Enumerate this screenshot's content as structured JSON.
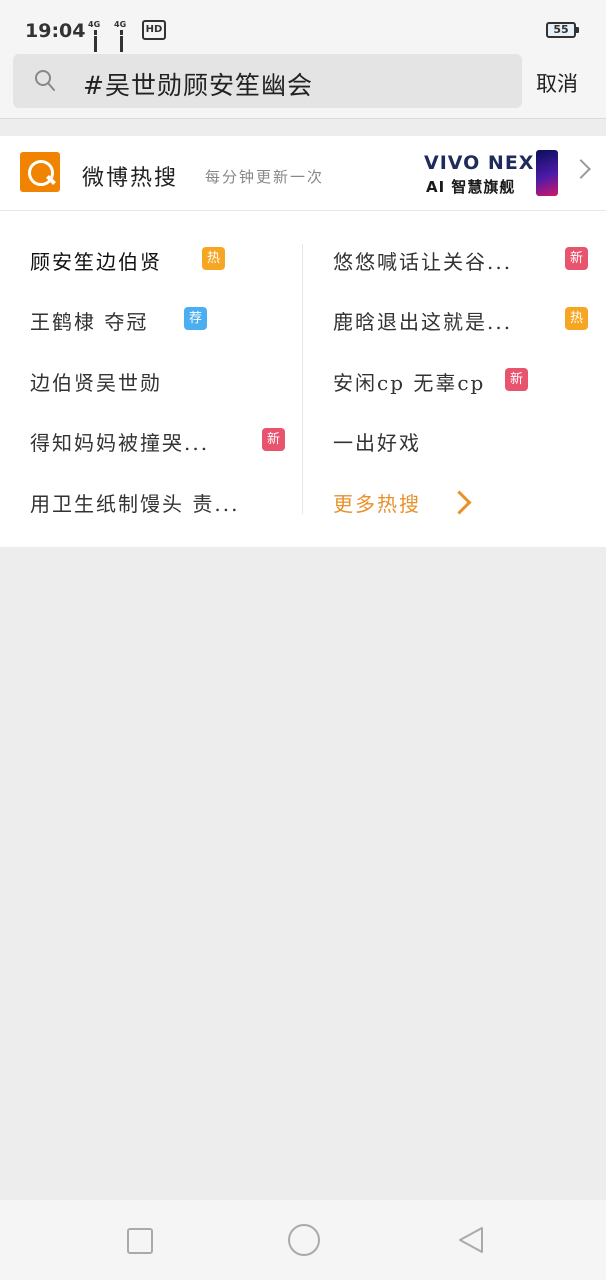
{
  "status_bar": {
    "time": "19:04",
    "network1": "4G",
    "network2": "4G",
    "hd_label": "HD",
    "battery": "55"
  },
  "search": {
    "query": "#吴世勋顾安笙幽会",
    "cancel_label": "取消"
  },
  "hot_search": {
    "title": "微博热搜",
    "subtitle": "每分钟更新一次",
    "ad": {
      "brand": "VIVO NEX",
      "tagline": "AI 智慧旗舰"
    },
    "left_items": [
      {
        "text": "顾安笙边伯贤",
        "badge": "热"
      },
      {
        "text": "王鹤棣 夺冠",
        "badge": "荐"
      },
      {
        "text": "边伯贤吴世勋",
        "badge": ""
      },
      {
        "text": "得知妈妈被撞哭...",
        "badge": "新"
      },
      {
        "text": "用卫生纸制馒头 责...",
        "badge": ""
      }
    ],
    "right_items": [
      {
        "text": "悠悠喊话让关谷...",
        "badge": "新"
      },
      {
        "text": "鹿晗退出这就是...",
        "badge": "热"
      },
      {
        "text": "安闲cp 无辜cp",
        "badge": "新"
      },
      {
        "text": "一出好戏",
        "badge": ""
      }
    ],
    "more_label": "更多热搜"
  },
  "colors": {
    "hot": "#f6a623",
    "new": "#e8536e",
    "recommended": "#4aaef0",
    "accent": "#e8912c",
    "logo": "#f08400"
  }
}
